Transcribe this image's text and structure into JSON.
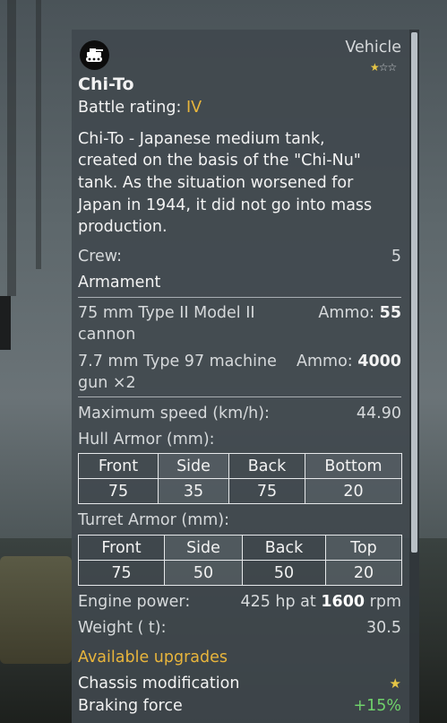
{
  "header": {
    "category": "Vehicle",
    "rank_stars": {
      "filled": 1,
      "total": 3
    },
    "name": "Chi-To",
    "battle_rating_label": "Battle rating:",
    "battle_rating_value": "IV"
  },
  "description": [
    "Chi-To - Japanese medium tank,",
    "created on the basis of the \"Chi-Nu\"",
    "tank. As the situation worsened for",
    "Japan in 1944, it did not go into mass",
    "production."
  ],
  "crew": {
    "label": "Crew:",
    "value": "5"
  },
  "armament": {
    "title": "Armament",
    "weapons": [
      {
        "name_line1": "75 mm Type II Model II",
        "name_line2": "cannon",
        "ammo_label": "Ammo:",
        "ammo_value": "55"
      },
      {
        "name_line1": "7.7 mm Type 97 machine",
        "name_line2": "gun ×2",
        "ammo_label": "Ammo:",
        "ammo_value": "4000"
      }
    ]
  },
  "max_speed": {
    "label": "Maximum speed (km/h):",
    "value": "44.90"
  },
  "hull_armor": {
    "label": "Hull Armor (mm):",
    "headers": [
      "Front",
      "Side",
      "Back",
      "Bottom"
    ],
    "values": [
      "75",
      "35",
      "75",
      "20"
    ]
  },
  "turret_armor": {
    "label": "Turret Armor (mm):",
    "headers": [
      "Front",
      "Side",
      "Back",
      "Top"
    ],
    "values": [
      "75",
      "50",
      "50",
      "20"
    ]
  },
  "engine": {
    "label": "Engine power:",
    "value_prefix": "425 hp at",
    "rpm": "1600",
    "unit": "rpm"
  },
  "weight": {
    "label": "Weight ( t):",
    "value": "30.5"
  },
  "upgrades": {
    "title": "Available upgrades",
    "items": [
      {
        "label": "Chassis modification",
        "value": "★"
      },
      {
        "label": "Braking force",
        "value": "+15%"
      }
    ]
  },
  "colors": {
    "accent_gold": "#e8b53c",
    "positive_green": "#6fd26b",
    "panel_bg": "#40484e"
  },
  "icons": {
    "vehicle_logo": "japan-tank-emblem-icon",
    "rank": "star-icon",
    "upgrade": "star-icon"
  }
}
